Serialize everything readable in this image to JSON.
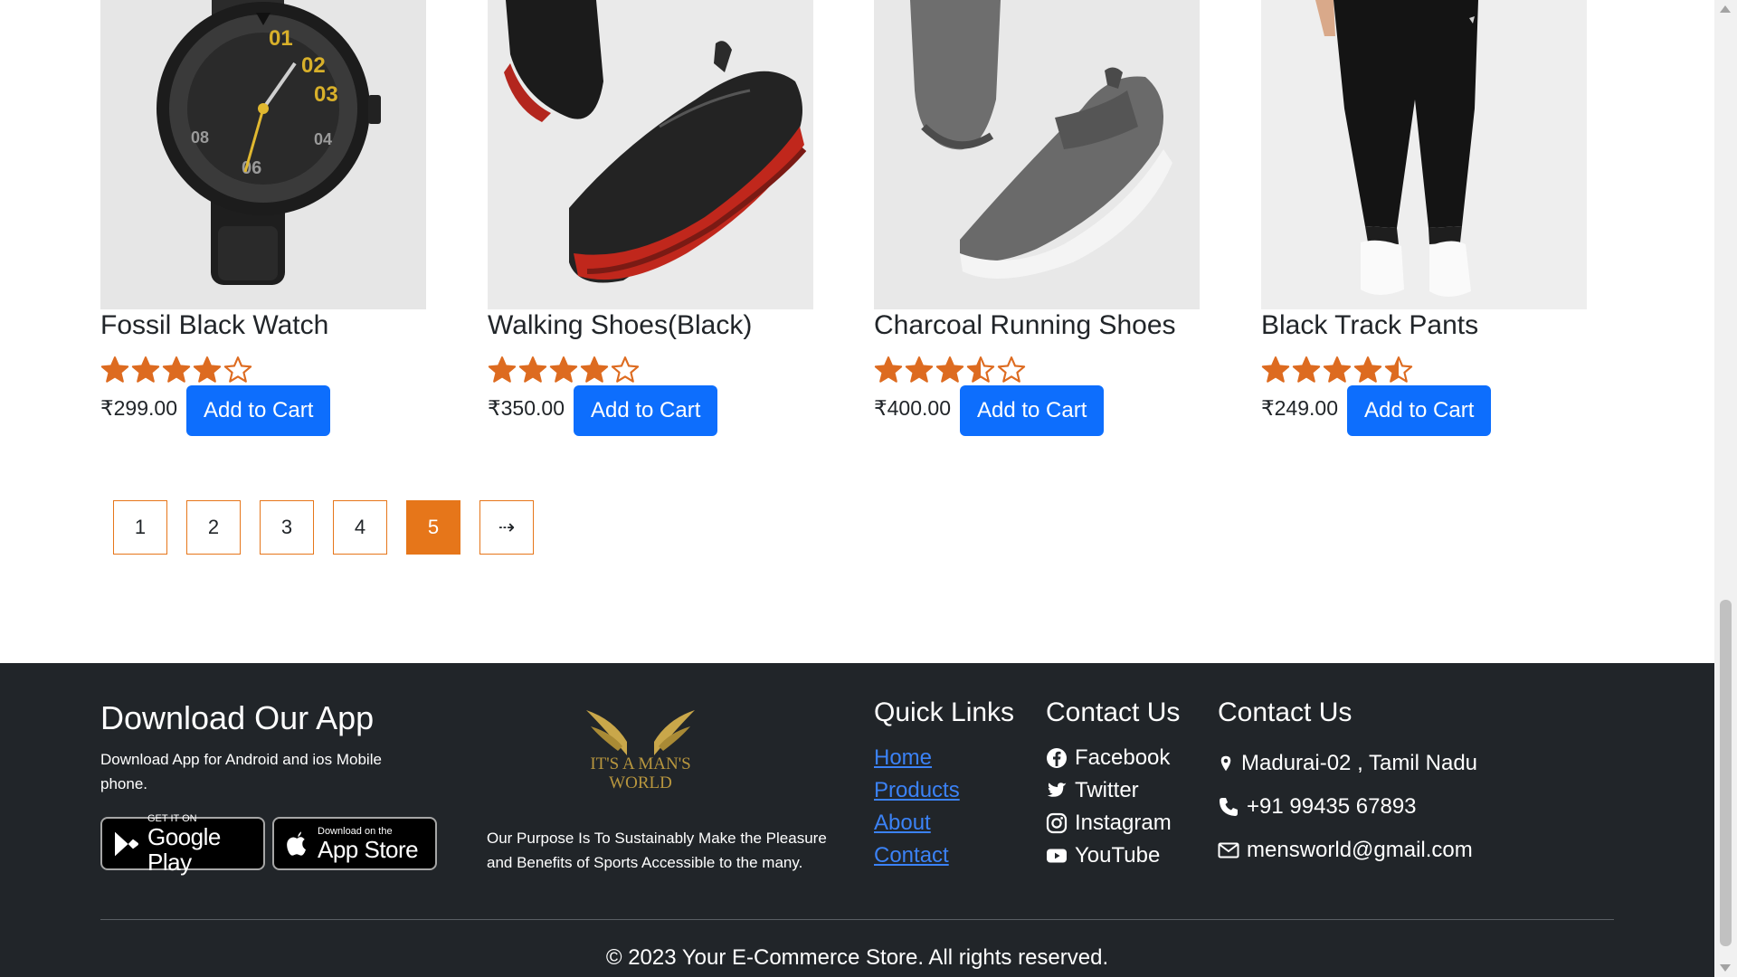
{
  "products": [
    {
      "title": "Fossil Black Watch",
      "rating": 4,
      "price": "₹299.00",
      "cta": "Add to Cart",
      "image_icon": "watch-image"
    },
    {
      "title": "Walking Shoes(Black)",
      "rating": 4,
      "price": "₹350.00",
      "cta": "Add to Cart",
      "image_icon": "shoe-image"
    },
    {
      "title": "Charcoal Running Shoes",
      "rating": 3.5,
      "price": "₹400.00",
      "cta": "Add to Cart",
      "image_icon": "shoe-image"
    },
    {
      "title": "Black Track Pants",
      "rating": 4.5,
      "price": "₹249.00",
      "cta": "Add to Cart",
      "image_icon": "pants-image"
    }
  ],
  "pagination": {
    "pages": [
      "1",
      "2",
      "3",
      "4",
      "5"
    ],
    "active": "5",
    "next_label": "⇢"
  },
  "footer": {
    "app": {
      "heading": "Download Our App",
      "text": "Download App for Android and ios Mobile phone.",
      "google": {
        "small": "GET IT ON",
        "big": "Google Play"
      },
      "apple": {
        "small": "Download on the",
        "big": "App Store"
      }
    },
    "brand": {
      "logo_line1": "IT'S A MAN'S",
      "logo_line2": "WORLD",
      "purpose": "Our Purpose Is To Sustainably Make the Pleasure and Benefits of Sports Accessible to the many."
    },
    "quick_links": {
      "heading": "Quick Links",
      "items": [
        "Home",
        "Products",
        "About",
        "Contact"
      ]
    },
    "social": {
      "heading": "Contact Us",
      "items": [
        {
          "label": "Facebook",
          "icon": "facebook-icon"
        },
        {
          "label": "Twitter",
          "icon": "twitter-icon"
        },
        {
          "label": "Instagram",
          "icon": "instagram-icon"
        },
        {
          "label": "YouTube",
          "icon": "youtube-icon"
        }
      ]
    },
    "contact": {
      "heading": "Contact Us",
      "address": "Madurai-02 , Tamil Nadu",
      "phone": "+91 99435 67893",
      "email": "mensworld@gmail.com"
    },
    "copyright": "© 2023 Your E-Commerce Store. All rights reserved."
  },
  "colors": {
    "accent": "#e6761a",
    "button": "#0d6efd",
    "star": "#dd6b20",
    "footer_bg": "#212529",
    "link": "#3b82f6",
    "logo_gold": "#c9a74a"
  }
}
